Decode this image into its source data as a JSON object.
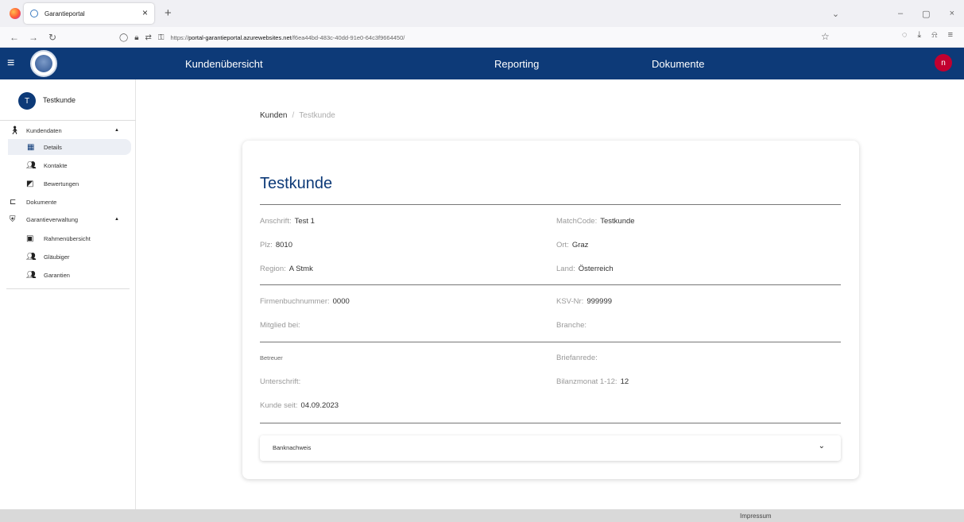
{
  "browser": {
    "tab_title": "Garantieportal",
    "tab_close": "×",
    "new_tab": "+",
    "url_prefix": "https://",
    "url_host": "portal-garantieportal.azurewebsites.net",
    "url_path": "/f6ea44bd-483c-40dd-91e0-64c3f9664450/",
    "window_controls": [
      "⌄",
      "–",
      "▢",
      "×"
    ],
    "toolbar_icons": [
      "shield-icon",
      "download-icon",
      "extensions-icon",
      "menu-icon"
    ]
  },
  "appbar": {
    "nav": {
      "kunden": "Kundenübersicht",
      "reporting": "Reporting",
      "dokumente": "Dokumente"
    },
    "user_initial": "n",
    "accent": "#0d3a78",
    "user_color": "#c2002f"
  },
  "sidebar": {
    "customer_initial": "T",
    "customer_name": "Testkunde",
    "kundendaten": "Kundendaten",
    "details": "Details",
    "kontakte": "Kontakte",
    "bewertungen": "Bewertungen",
    "dokumente": "Dokumente",
    "garantieverwaltung": "Garantieverwaltung",
    "rahmenuebersicht": "Rahmenübersicht",
    "glaeubiger": "Gläubiger",
    "garantien": "Garantien"
  },
  "breadcrumb": {
    "root": "Kunden",
    "separator": "/",
    "current": "Testkunde"
  },
  "customer": {
    "title": "Testkunde",
    "anschrift_label": "Anschrift:",
    "anschrift": "Test 1",
    "matchcode_label": "MatchCode:",
    "matchcode": "Testkunde",
    "plz_label": "Plz:",
    "plz": "8010",
    "ort_label": "Ort:",
    "ort": "Graz",
    "region_label": "Region:",
    "region": "A Stmk",
    "land_label": "Land:",
    "land": "Österreich",
    "firmenbuch_label": "Firmenbuchnummer:",
    "firmenbuch": "0000",
    "ksv_label": "KSV-Nr:",
    "ksv": "999999",
    "mitglied_label": "Mitglied bei:",
    "branche_label": "Branche:",
    "betreuer_label": "Betreuer",
    "briefanrede_label": "Briefanrede:",
    "unterschrift_label": "Unterschrift:",
    "bilanzmonat_label": "Bilanzmonat 1-12:",
    "bilanzmonat": "12",
    "kunde_seit_label": "Kunde seit:",
    "kunde_seit": "04.09.2023",
    "banknachweis": "Banknachweis"
  },
  "footer": {
    "impressum": "Impressum"
  }
}
